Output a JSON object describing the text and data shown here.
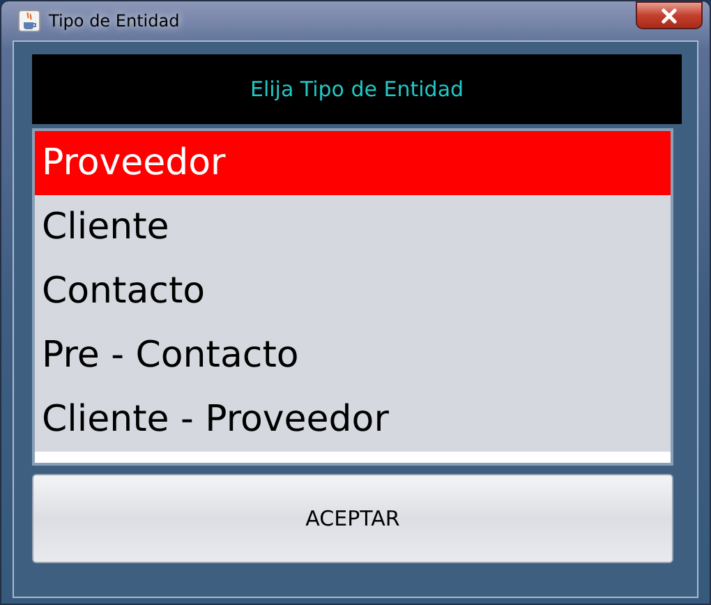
{
  "window": {
    "title": "Tipo de Entidad"
  },
  "header": "Elija Tipo de Entidad",
  "items": [
    {
      "label": "Proveedor",
      "selected": true
    },
    {
      "label": "Cliente",
      "selected": false
    },
    {
      "label": "Contacto",
      "selected": false
    },
    {
      "label": "Pre - Contacto",
      "selected": false
    },
    {
      "label": "Cliente - Proveedor",
      "selected": false
    }
  ],
  "buttons": [
    "ACEPTAR"
  ]
}
